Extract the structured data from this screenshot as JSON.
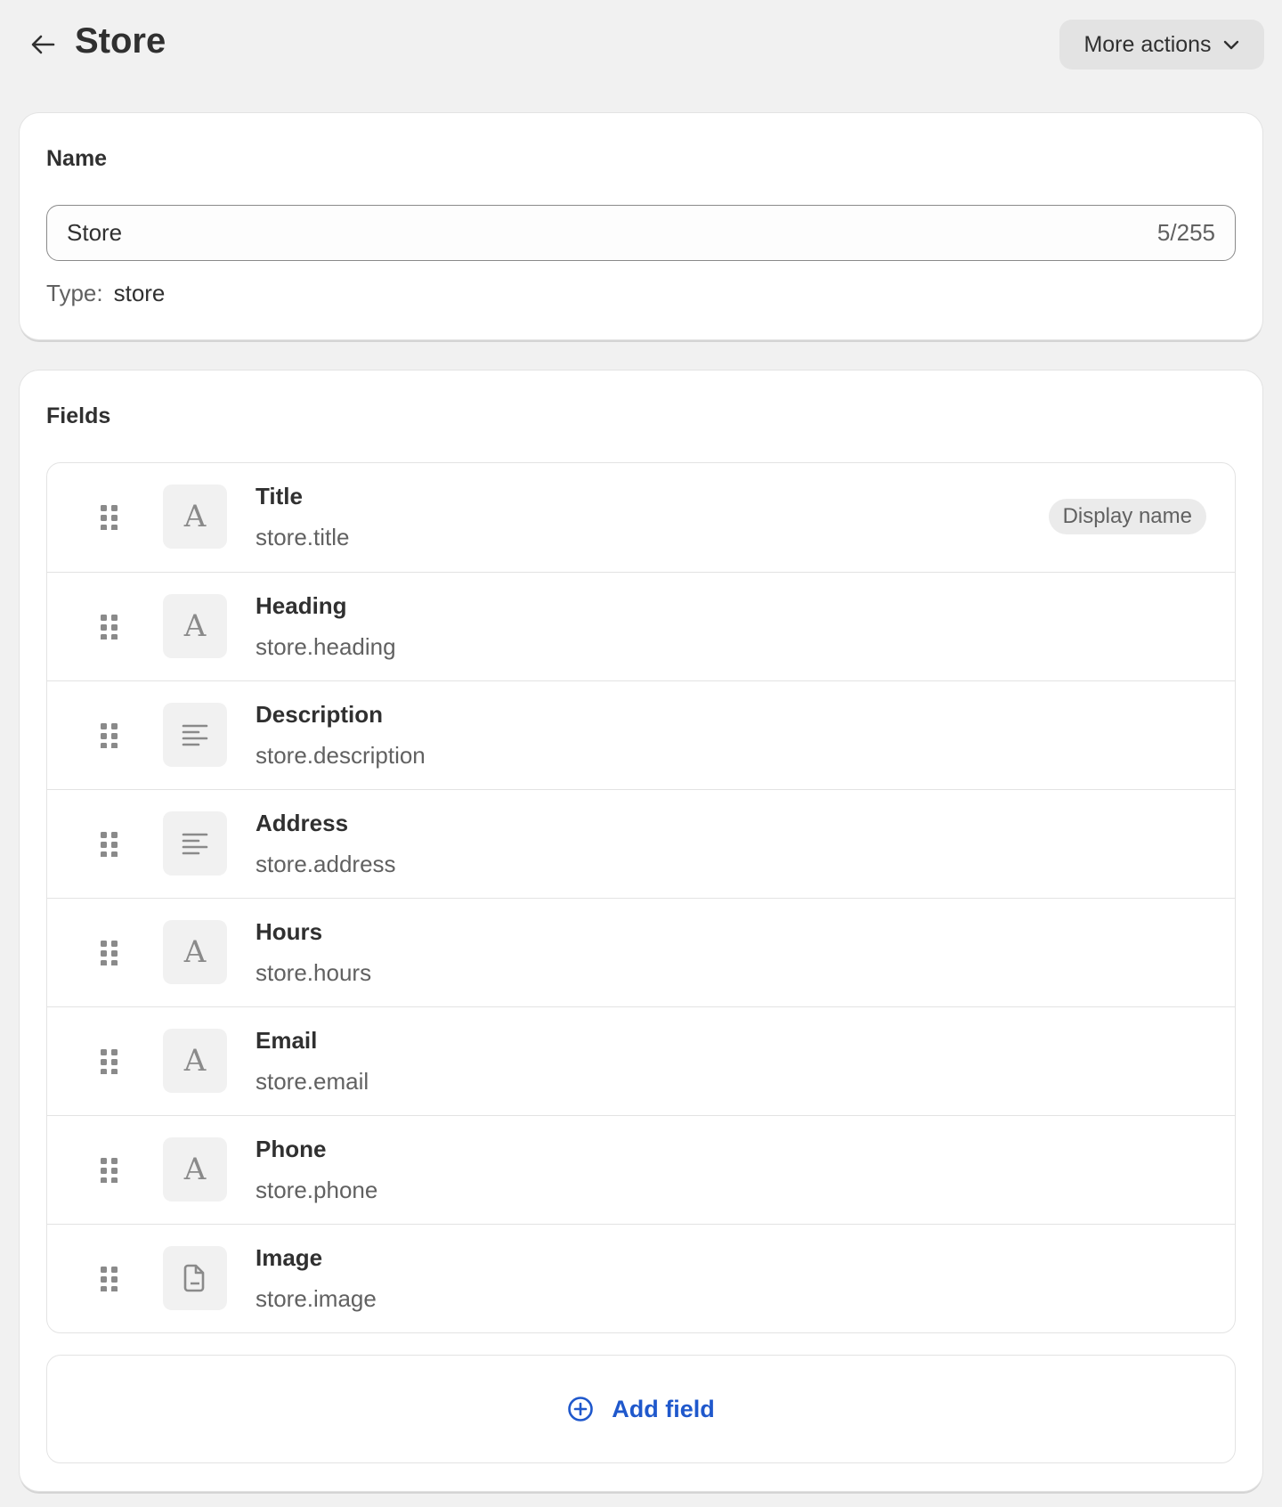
{
  "header": {
    "title": "Store",
    "more_actions": "More actions"
  },
  "name_card": {
    "label": "Name",
    "value": "Store",
    "count": "5/255",
    "type_label": "Type:",
    "type_value": "store"
  },
  "fields_card": {
    "label": "Fields",
    "add_label": "Add field",
    "items": [
      {
        "title": "Title",
        "key": "store.title",
        "icon": "text-icon",
        "badge": "Display name"
      },
      {
        "title": "Heading",
        "key": "store.heading",
        "icon": "text-icon"
      },
      {
        "title": "Description",
        "key": "store.description",
        "icon": "paragraph-icon"
      },
      {
        "title": "Address",
        "key": "store.address",
        "icon": "paragraph-icon"
      },
      {
        "title": "Hours",
        "key": "store.hours",
        "icon": "text-icon"
      },
      {
        "title": "Email",
        "key": "store.email",
        "icon": "text-icon"
      },
      {
        "title": "Phone",
        "key": "store.phone",
        "icon": "text-icon"
      },
      {
        "title": "Image",
        "key": "store.image",
        "icon": "file-icon"
      }
    ]
  },
  "colors": {
    "accent": "#1f58cc",
    "background": "#f1f1f1"
  }
}
